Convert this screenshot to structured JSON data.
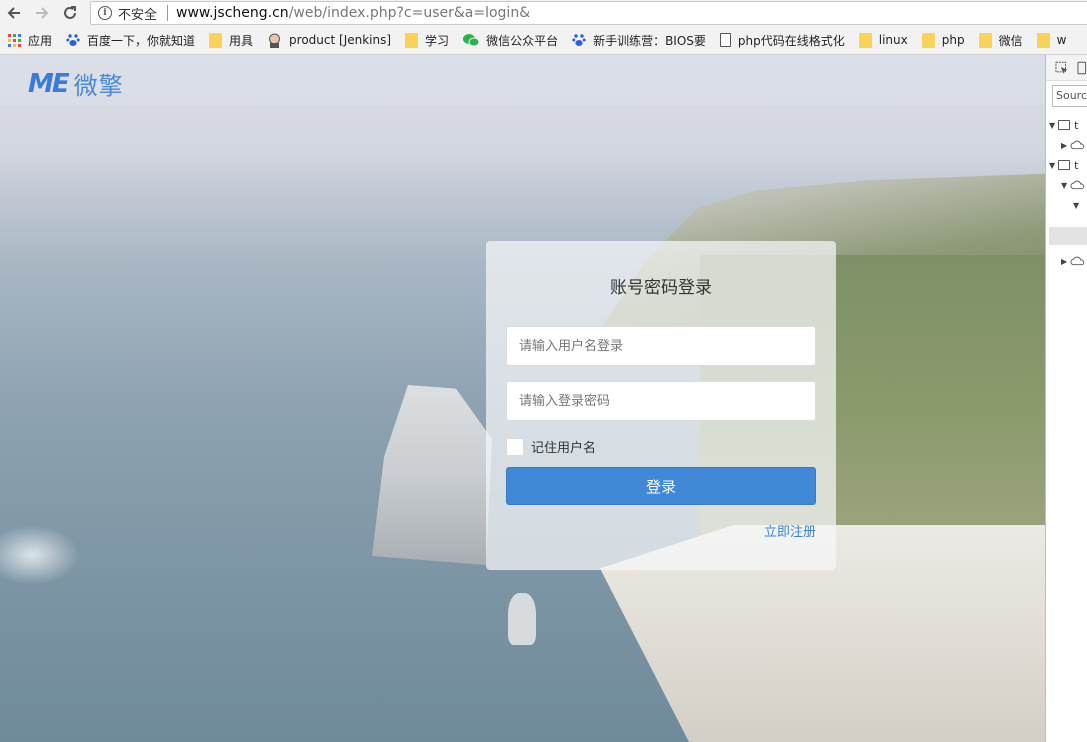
{
  "browser": {
    "insecure_label": "不安全",
    "url_host": "www.jscheng.cn",
    "url_path": "/web/index.php?c=user&a=login&"
  },
  "bookmarks": [
    {
      "label": "应用",
      "icon": "apps-grid-icon"
    },
    {
      "label": "百度一下，你就知道",
      "icon": "baidu-paw-icon"
    },
    {
      "label": "用具",
      "icon": "folder-icon"
    },
    {
      "label": "product [Jenkins]",
      "icon": "jenkins-icon"
    },
    {
      "label": "学习",
      "icon": "folder-icon"
    },
    {
      "label": "微信公众平台",
      "icon": "wechat-icon"
    },
    {
      "label": "新手训练营：BIOS要",
      "icon": "baidu-paw-icon"
    },
    {
      "label": "php代码在线格式化",
      "icon": "document-icon"
    },
    {
      "label": "linux",
      "icon": "folder-icon"
    },
    {
      "label": "php",
      "icon": "folder-icon"
    },
    {
      "label": "微信",
      "icon": "folder-icon"
    },
    {
      "label": "w",
      "icon": "folder-icon"
    }
  ],
  "logo": {
    "mark": "ME",
    "text": "微擎"
  },
  "login": {
    "title": "账号密码登录",
    "username_placeholder": "请输入用户名登录",
    "password_placeholder": "请输入登录密码",
    "remember_label": "记住用户名",
    "submit_label": "登录",
    "register_link": "立即注册"
  },
  "devtools": {
    "sources_label": "Source",
    "tree_labels": [
      "t",
      "t"
    ]
  },
  "colors": {
    "primary": "#4188d6",
    "link": "#3b82cf",
    "logo": "#3a7bd5"
  }
}
